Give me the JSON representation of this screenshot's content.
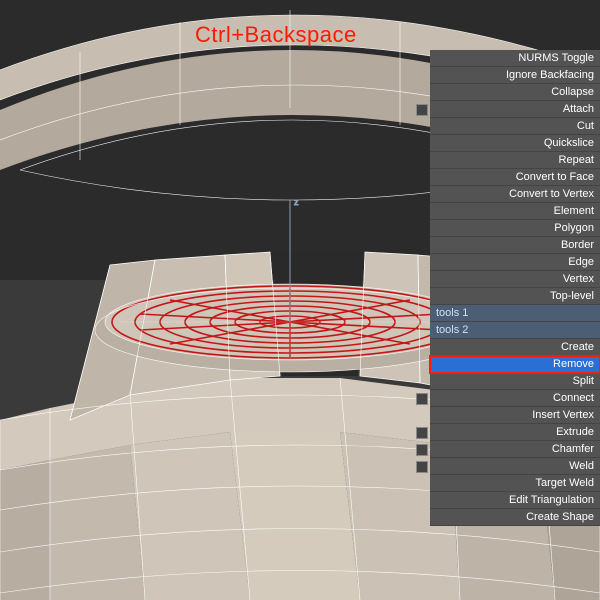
{
  "overlay": {
    "shortcut": "Ctrl+Backspace"
  },
  "menu": {
    "group1": [
      {
        "label": "NURMS Toggle",
        "icon_box": false,
        "check": false
      },
      {
        "label": "Ignore Backfacing",
        "icon_box": false,
        "check": false
      },
      {
        "label": "Collapse",
        "icon_box": false,
        "check": false
      },
      {
        "label": "Attach",
        "icon_box": true,
        "check": false
      },
      {
        "label": "Cut",
        "icon_box": false,
        "check": false
      },
      {
        "label": "Quickslice",
        "icon_box": false,
        "check": false
      },
      {
        "label": "Repeat",
        "icon_box": false,
        "check": false
      },
      {
        "label": "Convert to Face",
        "icon_box": false,
        "check": false
      },
      {
        "label": "Convert to Vertex",
        "icon_box": false,
        "check": false
      },
      {
        "label": "Element",
        "icon_box": false,
        "check": false
      },
      {
        "label": "Polygon",
        "icon_box": false,
        "check": false
      },
      {
        "label": "Border",
        "icon_box": false,
        "check": false
      },
      {
        "label": "Edge",
        "icon_box": false,
        "check": true
      },
      {
        "label": "Vertex",
        "icon_box": false,
        "check": false
      },
      {
        "label": "Top-level",
        "icon_box": false,
        "check": false
      }
    ],
    "tools_headers": [
      {
        "label": "tools 1"
      },
      {
        "label": "tools 2"
      }
    ],
    "group2": [
      {
        "label": "Create",
        "icon_box": false,
        "highlight": false,
        "remove": false
      },
      {
        "label": "Remove",
        "icon_box": false,
        "highlight": true,
        "remove": true
      },
      {
        "label": "Split",
        "icon_box": false,
        "highlight": false,
        "remove": false
      },
      {
        "label": "Connect",
        "icon_box": true,
        "highlight": false,
        "remove": false
      },
      {
        "label": "Insert Vertex",
        "icon_box": false,
        "highlight": false,
        "remove": false
      },
      {
        "label": "Extrude",
        "icon_box": true,
        "highlight": false,
        "remove": false
      },
      {
        "label": "Chamfer",
        "icon_box": true,
        "highlight": false,
        "remove": false
      },
      {
        "label": "Weld",
        "icon_box": true,
        "highlight": false,
        "remove": false
      },
      {
        "label": "Target Weld",
        "icon_box": false,
        "highlight": false,
        "remove": false
      },
      {
        "label": "Edit Triangulation",
        "icon_box": false,
        "highlight": false,
        "remove": false
      },
      {
        "label": "Create Shape",
        "icon_box": false,
        "highlight": false,
        "remove": false
      }
    ]
  }
}
